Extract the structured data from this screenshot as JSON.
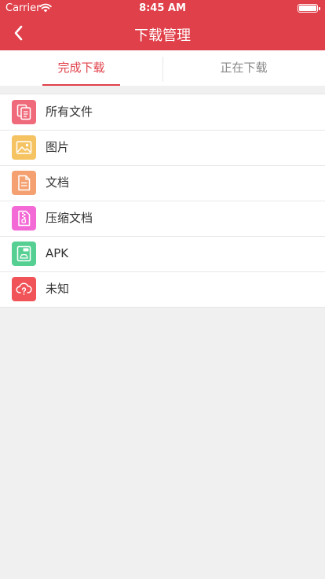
{
  "status_bar": {
    "carrier": "Carrier",
    "time": "8:45 AM"
  },
  "nav": {
    "title": "下载管理",
    "back_icon": "chevron-left-icon"
  },
  "tabs": [
    {
      "label": "完成下载",
      "active": true
    },
    {
      "label": "正在下载",
      "active": false
    }
  ],
  "file_types": [
    {
      "label": "所有文件",
      "icon": "all-files-icon",
      "color": "#ef6a7a"
    },
    {
      "label": "图片",
      "icon": "image-icon",
      "color": "#f5c362"
    },
    {
      "label": "文档",
      "icon": "document-icon",
      "color": "#f4a070"
    },
    {
      "label": "压缩文档",
      "icon": "zip-icon",
      "color": "#f36ad6"
    },
    {
      "label": "APK",
      "icon": "apk-icon",
      "color": "#56cf93"
    },
    {
      "label": "未知",
      "icon": "unknown-icon",
      "color": "#f05458"
    }
  ],
  "colors": {
    "accent": "#e0404a",
    "background": "#f0f0f0"
  }
}
